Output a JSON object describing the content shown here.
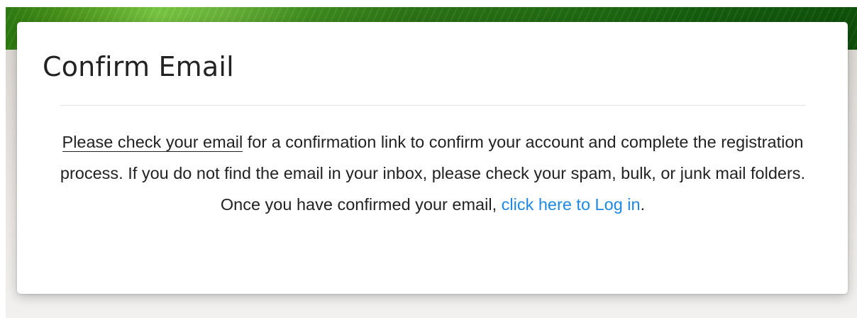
{
  "colors": {
    "banner_light": "#7ac943",
    "banner_dark": "#0f520b",
    "link_blue": "#1e88e5",
    "text": "#222222"
  },
  "card": {
    "title": "Confirm Email",
    "message": {
      "check_email_link": "Please check your email",
      "body": " for a confirmation link to confirm your account and complete the registration process. If you do not find the email in your inbox, please check your spam, bulk, or junk mail folders. Once you have confirmed your email, ",
      "login_link": "click here to Log in",
      "end": "."
    }
  }
}
